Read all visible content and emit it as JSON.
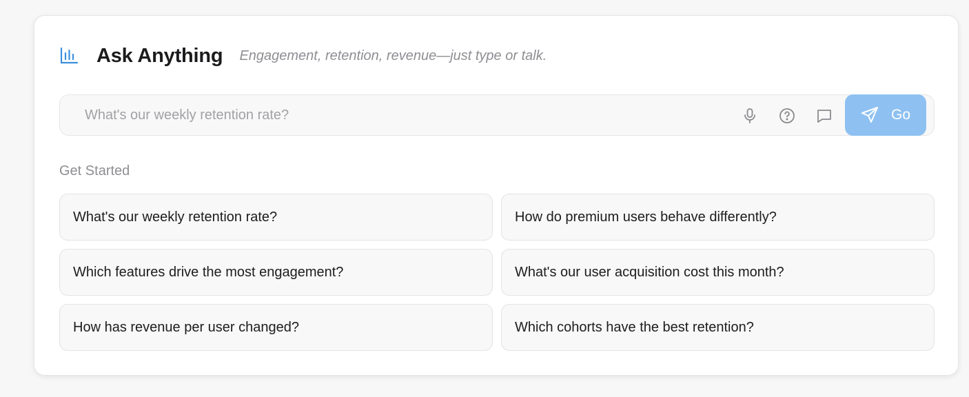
{
  "header": {
    "icon": "bar-chart-icon",
    "title": "Ask Anything",
    "subtitle": "Engagement, retention, revenue—just type or talk."
  },
  "search": {
    "placeholder": "What's our weekly retention rate?",
    "value": "",
    "icons": [
      "microphone-icon",
      "help-icon",
      "chat-icon"
    ],
    "go_label": "Go"
  },
  "section_label": "Get Started",
  "suggestions": [
    "What's our weekly retention rate?",
    "How do premium users behave differently?",
    "Which features drive the most engagement?",
    "What's our user acquisition cost this month?",
    "How has revenue per user changed?",
    "Which cohorts have the best retention?"
  ],
  "colors": {
    "accent": "#3b8fde",
    "go_button": "#8ec1f2",
    "text_primary": "#1c1c1e",
    "text_muted": "#8e8e93"
  }
}
